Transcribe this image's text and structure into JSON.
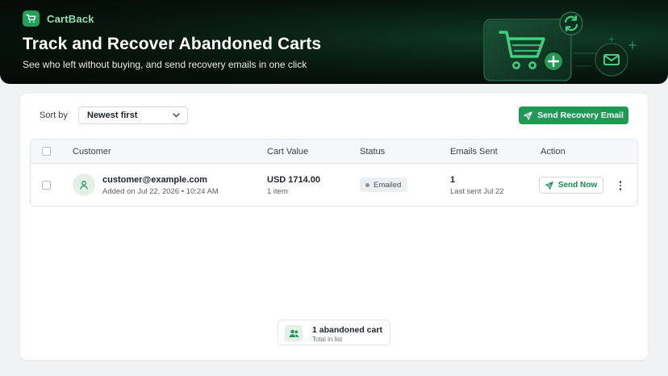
{
  "brand": {
    "name": "CartBack"
  },
  "hero": {
    "title": "Track and Recover Abandoned Carts",
    "subtitle": "See who left without buying, and send recovery emails in one click"
  },
  "toolbar": {
    "sort_label": "Sort by",
    "sort_value": "Newest first",
    "send_recovery_label": "Send Recovery Email"
  },
  "table": {
    "headers": {
      "customer": "Customer",
      "cart_value": "Cart Value",
      "status": "Status",
      "emails_sent": "Emails Sent",
      "action": "Action"
    },
    "rows": [
      {
        "customer_email": "customer@example.com",
        "added": "Added on Jul 22, 2026 • 10:24 AM",
        "cart_value": "USD 1714.00",
        "items": "1 item",
        "status": "Emailed",
        "emails_sent": "1",
        "last_sent": "Last sent Jul 22",
        "action_label": "Send Now"
      }
    ]
  },
  "summary": {
    "count_label": "1 abandoned cart",
    "sub_label": "Total in list"
  },
  "colors": {
    "accent": "#1f9a55",
    "hero_bg": "#07130d",
    "accent_text": "#1b8a4c"
  },
  "icons": {
    "brand": "cart-icon",
    "sort": "chevron-down-icon",
    "send": "paper-plane-icon",
    "avatar": "user-icon",
    "more": "more-vertical-icon",
    "summary": "users-icon"
  }
}
